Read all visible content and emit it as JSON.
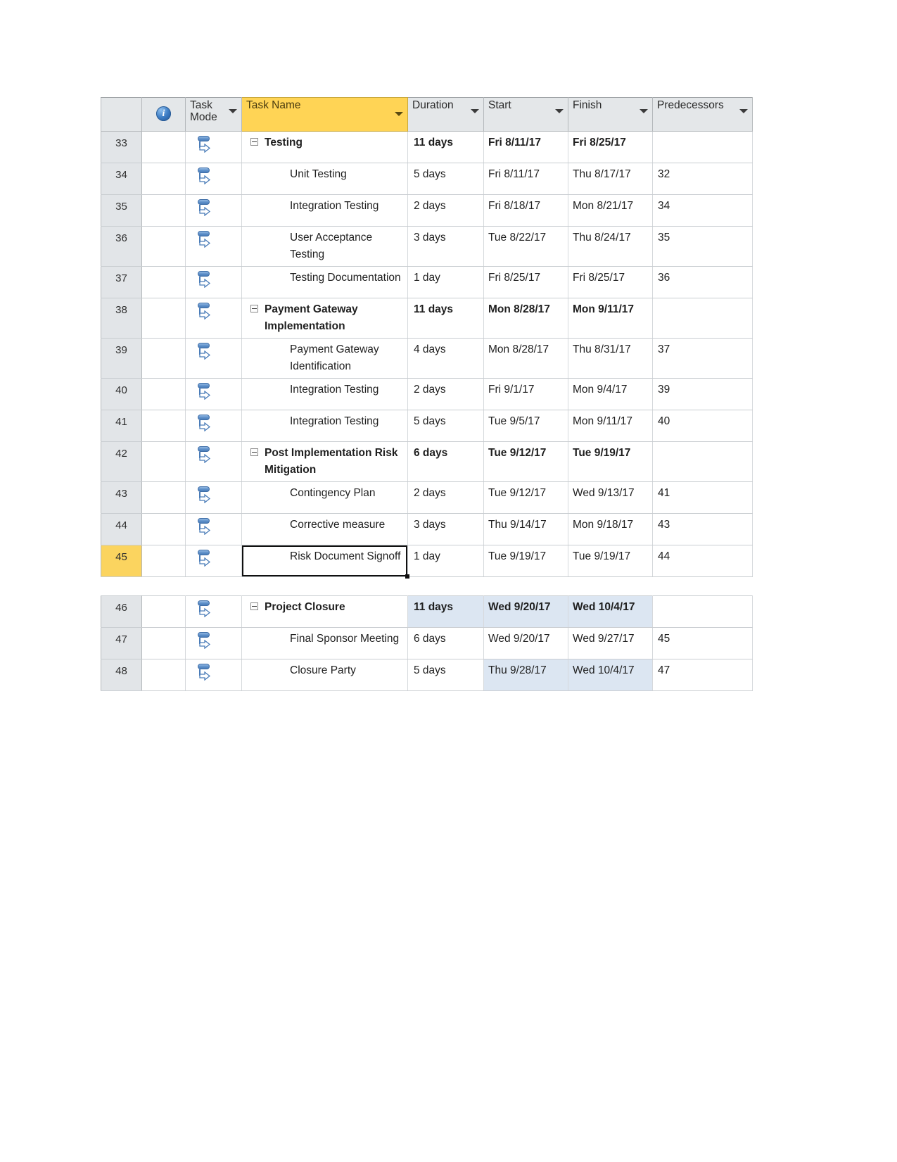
{
  "view": {
    "app": "Microsoft Project",
    "view_name": "Gantt Chart Entry Table",
    "accent_header_color": "#FFD455",
    "selected_row_color": "#FBD45F",
    "highlight_cell_color": "#DCE6F2"
  },
  "columns": [
    {
      "key": "id",
      "label": "",
      "icon": "",
      "sortable": false
    },
    {
      "key": "info",
      "label": "",
      "icon": "info-icon",
      "sortable": false
    },
    {
      "key": "mode",
      "label": "Task Mode",
      "icon": "chevron-down-icon",
      "sortable": true
    },
    {
      "key": "name",
      "label": "Task Name",
      "icon": "chevron-down-icon",
      "sortable": true
    },
    {
      "key": "dur",
      "label": "Duration",
      "icon": "chevron-down-icon",
      "sortable": true
    },
    {
      "key": "start",
      "label": "Start",
      "icon": "chevron-down-icon",
      "sortable": true
    },
    {
      "key": "fin",
      "label": "Finish",
      "icon": "chevron-down-icon",
      "sortable": true
    },
    {
      "key": "pred",
      "label": "Predecessors",
      "icon": "chevron-down-icon",
      "sortable": true
    }
  ],
  "upper_rows": [
    {
      "id": "33",
      "name": "Testing",
      "level": 0,
      "summary": true,
      "collapse": true,
      "dur": "11 days",
      "start": "Fri 8/11/17",
      "fin": "Fri 8/25/17",
      "pred": "",
      "mode": "auto-scheduled-icon"
    },
    {
      "id": "34",
      "name": "Unit Testing",
      "level": 1,
      "summary": false,
      "collapse": false,
      "dur": "5 days",
      "start": "Fri 8/11/17",
      "fin": "Thu 8/17/17",
      "pred": "32",
      "mode": "auto-scheduled-icon"
    },
    {
      "id": "35",
      "name": "Integration Testing",
      "level": 1,
      "summary": false,
      "collapse": false,
      "dur": "2 days",
      "start": "Fri 8/18/17",
      "fin": "Mon 8/21/17",
      "pred": "34",
      "mode": "auto-scheduled-icon"
    },
    {
      "id": "36",
      "name": "User Acceptance Testing",
      "level": 1,
      "summary": false,
      "collapse": false,
      "dur": "3 days",
      "start": "Tue 8/22/17",
      "fin": "Thu 8/24/17",
      "pred": "35",
      "mode": "auto-scheduled-icon"
    },
    {
      "id": "37",
      "name": "Testing Documentation",
      "level": 1,
      "summary": false,
      "collapse": false,
      "dur": "1 day",
      "start": "Fri 8/25/17",
      "fin": "Fri 8/25/17",
      "pred": "36",
      "mode": "auto-scheduled-icon"
    },
    {
      "id": "38",
      "name": "Payment Gateway Implementation",
      "level": 0,
      "summary": true,
      "collapse": true,
      "dur": "11 days",
      "start": "Mon 8/28/17",
      "fin": "Mon 9/11/17",
      "pred": "",
      "mode": "auto-scheduled-icon"
    },
    {
      "id": "39",
      "name": "Payment Gateway Identification",
      "level": 1,
      "summary": false,
      "collapse": false,
      "dur": "4 days",
      "start": "Mon 8/28/17",
      "fin": "Thu 8/31/17",
      "pred": "37",
      "mode": "auto-scheduled-icon"
    },
    {
      "id": "40",
      "name": "Integration Testing",
      "level": 1,
      "summary": false,
      "collapse": false,
      "dur": "2 days",
      "start": "Fri 9/1/17",
      "fin": "Mon 9/4/17",
      "pred": "39",
      "mode": "auto-scheduled-icon"
    },
    {
      "id": "41",
      "name": "Integration Testing",
      "level": 1,
      "summary": false,
      "collapse": false,
      "dur": "5 days",
      "start": "Tue 9/5/17",
      "fin": "Mon 9/11/17",
      "pred": "40",
      "mode": "auto-scheduled-icon"
    },
    {
      "id": "42",
      "name": "Post Implementation Risk Mitigation",
      "level": 0,
      "summary": true,
      "collapse": true,
      "dur": "6 days",
      "start": "Tue 9/12/17",
      "fin": "Tue 9/19/17",
      "pred": "",
      "mode": "auto-scheduled-icon"
    },
    {
      "id": "43",
      "name": "Contingency Plan",
      "level": 1,
      "summary": false,
      "collapse": false,
      "dur": "2 days",
      "start": "Tue 9/12/17",
      "fin": "Wed 9/13/17",
      "pred": "41",
      "mode": "auto-scheduled-icon"
    },
    {
      "id": "44",
      "name": "Corrective measure",
      "level": 1,
      "summary": false,
      "collapse": false,
      "dur": "3 days",
      "start": "Thu 9/14/17",
      "fin": "Mon 9/18/17",
      "pred": "43",
      "mode": "auto-scheduled-icon"
    },
    {
      "id": "45",
      "name": "Risk Document Signoff",
      "level": 1,
      "summary": false,
      "collapse": false,
      "dur": "1 day",
      "start": "Tue 9/19/17",
      "fin": "Tue 9/19/17",
      "pred": "44",
      "mode": "auto-scheduled-icon",
      "selected_row": true,
      "selected_cell": "name"
    }
  ],
  "lower_rows": [
    {
      "id": "46",
      "name": "Project Closure",
      "level": 0,
      "summary": true,
      "collapse": true,
      "dur": "11 days",
      "start": "Wed 9/20/17",
      "fin": "Wed 10/4/17",
      "pred": "",
      "mode": "auto-scheduled-icon",
      "highlight": [
        "dur",
        "start",
        "fin"
      ]
    },
    {
      "id": "47",
      "name": "Final Sponsor Meeting",
      "level": 1,
      "summary": false,
      "collapse": false,
      "dur": "6 days",
      "start": "Wed 9/20/17",
      "fin": "Wed 9/27/17",
      "pred": "45",
      "mode": "auto-scheduled-icon",
      "highlight": []
    },
    {
      "id": "48",
      "name": "Closure Party",
      "level": 1,
      "summary": false,
      "collapse": false,
      "dur": "5 days",
      "start": "Thu 9/28/17",
      "fin": "Wed 10/4/17",
      "pred": "47",
      "mode": "auto-scheduled-icon",
      "highlight": [
        "start",
        "fin"
      ]
    }
  ]
}
